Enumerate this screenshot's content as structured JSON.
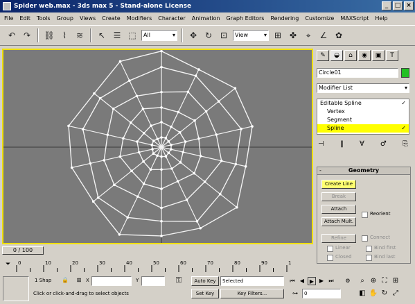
{
  "window": {
    "title": "Spider web.max - 3ds max 5 - Stand-alone License"
  },
  "menu": [
    "File",
    "Edit",
    "Tools",
    "Group",
    "Views",
    "Create",
    "Modifiers",
    "Character",
    "Animation",
    "Graph Editors",
    "Rendering",
    "Customize",
    "MAXScript",
    "Help"
  ],
  "toolbar": {
    "filter": "All",
    "ref_coord": "View"
  },
  "command_panel": {
    "tabs": [
      "✎",
      "◒",
      "⌂",
      "◉",
      "▣",
      "T"
    ],
    "object_name": "Circle01",
    "object_color": "#22c022",
    "modifier_list": "Modifier List",
    "stack": [
      {
        "label": "Editable Spline",
        "level": 0
      },
      {
        "label": "Vertex",
        "level": 1
      },
      {
        "label": "Segment",
        "level": 1
      },
      {
        "label": "Spline",
        "level": 1,
        "selected": true
      }
    ],
    "stack_icons": [
      "⊣",
      "‖",
      "∀",
      "♂",
      "⎘"
    ],
    "rollout": {
      "title": "Geometry",
      "create_line": "Create Line",
      "break": "Break",
      "attach": "Attach",
      "reorient": "Reorient",
      "attach_mult": "Attach Mult.",
      "refine": "Refine",
      "connect": "Connect",
      "linear": "Linear",
      "bind_first": "Bind first",
      "closed": "Closed",
      "bind_last": "Bind last"
    }
  },
  "time": {
    "frame": "0 / 100",
    "ticks": [
      "0",
      "10",
      "20",
      "30",
      "40",
      "50",
      "60",
      "70",
      "80",
      "90",
      "100"
    ]
  },
  "status": {
    "snap": "1 Shap",
    "x_label": "X",
    "y_label": "Y",
    "autokey": "Auto Key",
    "selected": "Selected",
    "setkey": "Set Key",
    "key_filters": "Key Filters...",
    "frame_value": "0",
    "prompt": "Click or click-and-drag to select objects"
  }
}
